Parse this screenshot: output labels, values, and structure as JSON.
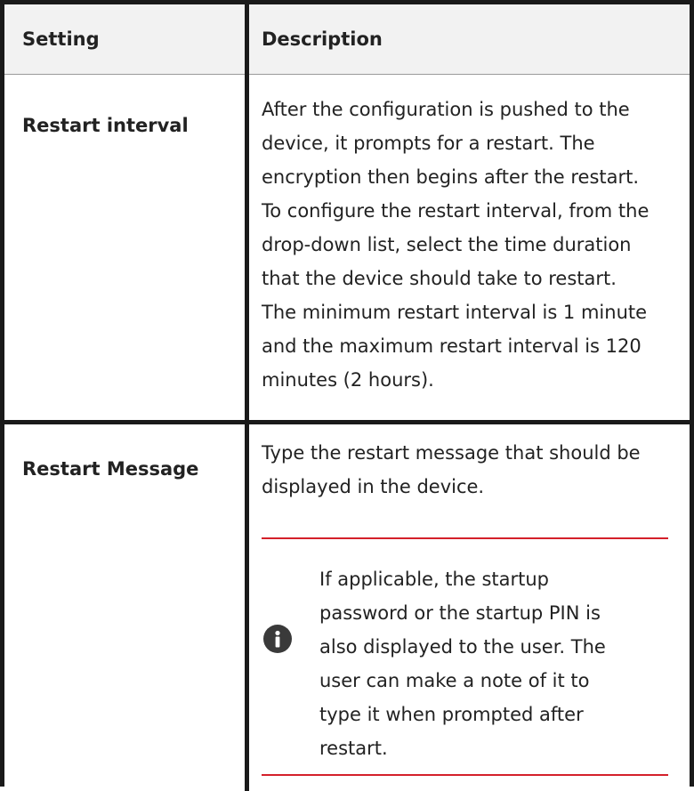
{
  "table": {
    "headers": {
      "setting": "Setting",
      "description": "Description"
    },
    "rows": [
      {
        "setting": "Restart interval",
        "description_lines": [
          "After the configuration is pushed to the",
          "device, it prompts for a restart. The",
          "encryption then begins after the restart.",
          "To configure the restart interval, from the",
          "drop-down list, select the time duration",
          "that the device should take to restart.",
          "The minimum restart interval is 1 minute",
          "and the maximum restart interval is 120",
          "minutes (2 hours)."
        ]
      },
      {
        "setting": "Restart Message",
        "description_lines": [
          "Type the restart message that should be",
          "displayed in the device."
        ],
        "note": {
          "icon": "info-icon",
          "accent_color": "#d4202a",
          "lines": [
            "If applicable, the startup",
            "password or the startup PIN is",
            "also displayed to the user. The",
            "user can make a note of it to",
            "type it when prompted after",
            "restart."
          ]
        }
      }
    ]
  }
}
